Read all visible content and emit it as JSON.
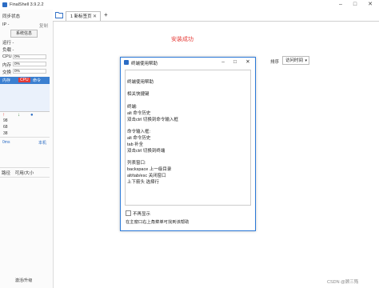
{
  "window": {
    "title": "FinalShell 3.9.2.2",
    "controls": [
      "–",
      "□",
      "✕"
    ]
  },
  "sidebar": {
    "sync_status": "同步状态",
    "ip_label": "IP -",
    "copy": "复制",
    "sync_btn": "系统信息",
    "run_label": "运行 -",
    "load_label": "负载 -",
    "meters": [
      {
        "label": "CPU",
        "value": "0%"
      },
      {
        "label": "内存",
        "value": "0%"
      },
      {
        "label": "交换",
        "value": "0%"
      }
    ],
    "tabs": [
      "内存",
      "CPU",
      "命令"
    ],
    "speed_values": [
      "98",
      "68",
      "38"
    ],
    "net_header": [
      "0ms",
      "本机"
    ],
    "bottom_tabs": [
      "路径",
      "可用/大小"
    ],
    "upgrade": "激活/升级"
  },
  "tabbar": {
    "tab_label": "1 新标签页",
    "close": "✕",
    "plus": "+"
  },
  "main": {
    "success_text": "安装成功",
    "sort_label": "排序",
    "sort_value": "访问时间"
  },
  "dialog": {
    "title": "终端使用帮助",
    "controls": [
      "–",
      "□",
      "✕"
    ],
    "lines": [
      "终端使用帮助",
      "",
      "相关快捷键",
      "",
      "终端:",
      "alt 命令历史",
      "双击ctrl 切换到命令输入框",
      "",
      "命令输入框:",
      "alt 命令历史",
      "tab 补全",
      "双击ctrl 切换到终端",
      "",
      "列表窗口:",
      "backspace 上一级目录",
      "alt/tab/esc 关闭窗口",
      "上下箭头 选择行"
    ],
    "checkbox_label": "不再显示",
    "footer": "在主窗口右上角菜单可找到该帮助"
  },
  "watermark": "CSDN @顾三殇"
}
